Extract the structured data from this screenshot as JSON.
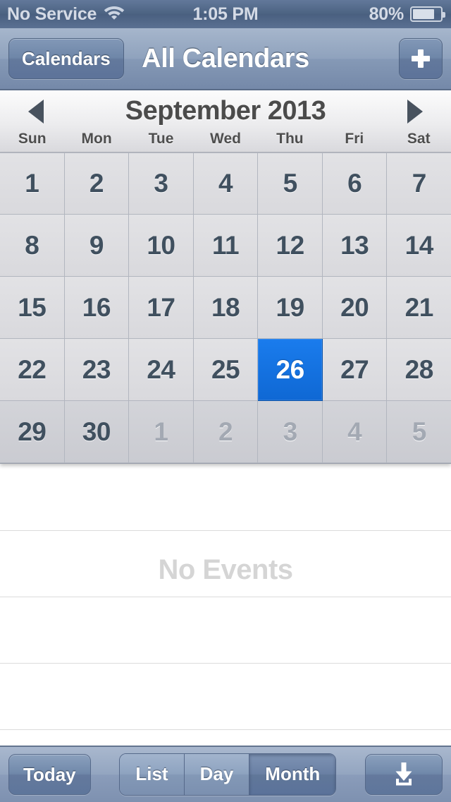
{
  "status_bar": {
    "carrier": "No Service",
    "wifi_icon": "wifi-icon",
    "time": "1:05 PM",
    "battery_percent": "80%",
    "battery_level": 80,
    "battery_icon": "battery-icon"
  },
  "nav_bar": {
    "back_label": "Calendars",
    "title": "All Calendars",
    "add_icon": "plus-icon"
  },
  "month_header": {
    "prev_icon": "triangle-left-icon",
    "title": "September 2013",
    "next_icon": "triangle-right-icon",
    "weekdays": [
      "Sun",
      "Mon",
      "Tue",
      "Wed",
      "Thu",
      "Fri",
      "Sat"
    ]
  },
  "calendar": {
    "month": "September",
    "year": "2013",
    "selected_day": "26",
    "selected_color": "#0f6cd6",
    "weeks": [
      [
        {
          "day": "1",
          "current_month": true,
          "selected": false
        },
        {
          "day": "2",
          "current_month": true,
          "selected": false
        },
        {
          "day": "3",
          "current_month": true,
          "selected": false
        },
        {
          "day": "4",
          "current_month": true,
          "selected": false
        },
        {
          "day": "5",
          "current_month": true,
          "selected": false
        },
        {
          "day": "6",
          "current_month": true,
          "selected": false
        },
        {
          "day": "7",
          "current_month": true,
          "selected": false
        }
      ],
      [
        {
          "day": "8",
          "current_month": true,
          "selected": false
        },
        {
          "day": "9",
          "current_month": true,
          "selected": false
        },
        {
          "day": "10",
          "current_month": true,
          "selected": false
        },
        {
          "day": "11",
          "current_month": true,
          "selected": false
        },
        {
          "day": "12",
          "current_month": true,
          "selected": false
        },
        {
          "day": "13",
          "current_month": true,
          "selected": false
        },
        {
          "day": "14",
          "current_month": true,
          "selected": false
        }
      ],
      [
        {
          "day": "15",
          "current_month": true,
          "selected": false
        },
        {
          "day": "16",
          "current_month": true,
          "selected": false
        },
        {
          "day": "17",
          "current_month": true,
          "selected": false
        },
        {
          "day": "18",
          "current_month": true,
          "selected": false
        },
        {
          "day": "19",
          "current_month": true,
          "selected": false
        },
        {
          "day": "20",
          "current_month": true,
          "selected": false
        },
        {
          "day": "21",
          "current_month": true,
          "selected": false
        }
      ],
      [
        {
          "day": "22",
          "current_month": true,
          "selected": false
        },
        {
          "day": "23",
          "current_month": true,
          "selected": false
        },
        {
          "day": "24",
          "current_month": true,
          "selected": false
        },
        {
          "day": "25",
          "current_month": true,
          "selected": false
        },
        {
          "day": "26",
          "current_month": true,
          "selected": true
        },
        {
          "day": "27",
          "current_month": true,
          "selected": false
        },
        {
          "day": "28",
          "current_month": true,
          "selected": false
        }
      ],
      [
        {
          "day": "29",
          "current_month": true,
          "selected": false
        },
        {
          "day": "30",
          "current_month": true,
          "selected": false
        },
        {
          "day": "1",
          "current_month": false,
          "selected": false
        },
        {
          "day": "2",
          "current_month": false,
          "selected": false
        },
        {
          "day": "3",
          "current_month": false,
          "selected": false
        },
        {
          "day": "4",
          "current_month": false,
          "selected": false
        },
        {
          "day": "5",
          "current_month": false,
          "selected": false
        }
      ]
    ]
  },
  "event_list": {
    "empty_message": "No Events",
    "separator_count": 4
  },
  "toolbar": {
    "today_label": "Today",
    "segments": [
      {
        "label": "List",
        "active": false
      },
      {
        "label": "Day",
        "active": false
      },
      {
        "label": "Month",
        "active": true
      }
    ],
    "action_icon": "download-icon"
  }
}
